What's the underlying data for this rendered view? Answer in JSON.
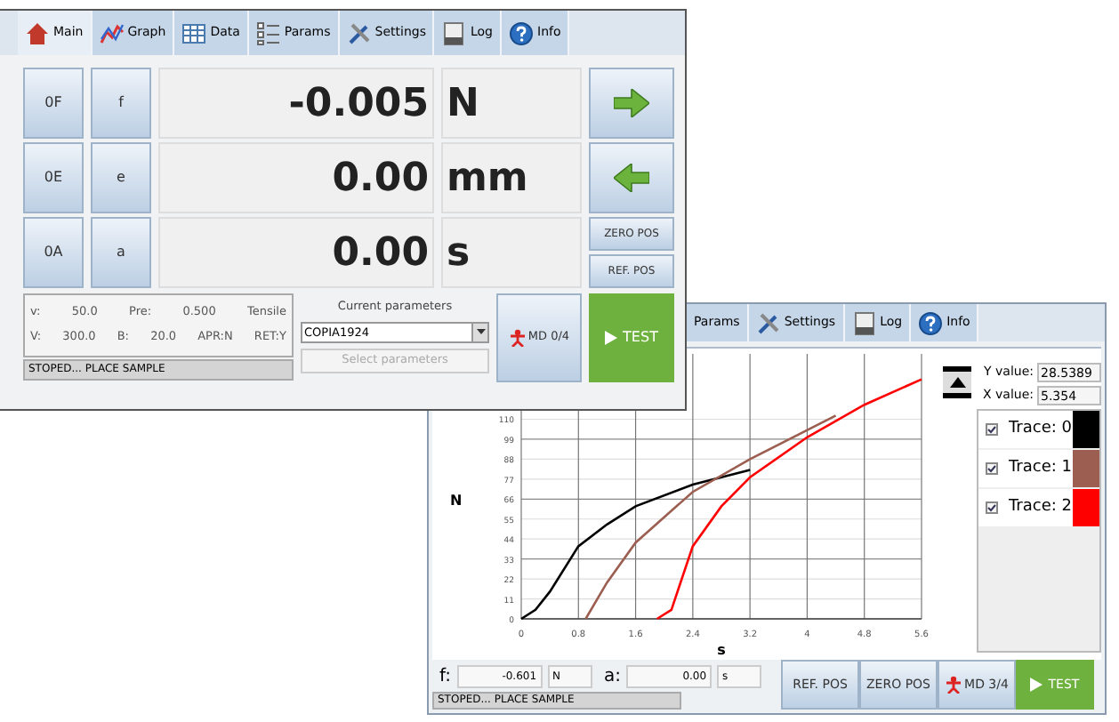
{
  "graph_window": {
    "tabs": [
      {
        "label": "Params",
        "selected": false,
        "kind": "none"
      },
      {
        "label": "Settings",
        "selected": false,
        "kind": "settings"
      },
      {
        "label": "Log",
        "selected": false,
        "kind": "log"
      },
      {
        "label": "Info",
        "selected": false,
        "kind": "info"
      }
    ],
    "chart_data": {
      "type": "line",
      "xlabel": "s",
      "ylabel": "N",
      "x": [
        0,
        0.2,
        0.4,
        0.8,
        0.9,
        1.2,
        1.6,
        1.9,
        2.1,
        2.4,
        2.8,
        3.2,
        4.0,
        4.4,
        4.8,
        5.6
      ],
      "series": [
        {
          "color": "#000000",
          "values": [
            0,
            5,
            15,
            40,
            null,
            52,
            62,
            null,
            null,
            74,
            null,
            82,
            null,
            null,
            null,
            null
          ]
        },
        {
          "color": "#9b5e50",
          "values": [
            null,
            null,
            null,
            null,
            0,
            20,
            42,
            null,
            null,
            70,
            null,
            88,
            null,
            112,
            null,
            null
          ]
        },
        {
          "color": "#ff0000",
          "values": [
            null,
            null,
            null,
            null,
            null,
            null,
            null,
            0,
            5,
            40,
            62,
            78,
            100,
            null,
            118,
            132
          ]
        }
      ],
      "grid": true,
      "xlim": [
        0,
        5.6
      ],
      "ylim": [
        0,
        146
      ],
      "xticks": [
        {
          "value": 0,
          "label": "0"
        },
        {
          "value": 0.8,
          "label": "0.8"
        },
        {
          "value": 1.6,
          "label": "1.6"
        },
        {
          "value": 2.4,
          "label": "2.4"
        },
        {
          "value": 3.2,
          "label": "3.2"
        },
        {
          "value": 4,
          "label": "4"
        },
        {
          "value": 4.8,
          "label": "4.8"
        },
        {
          "value": 5.6,
          "label": "5.6"
        }
      ],
      "yticks": [
        0,
        11,
        22,
        33,
        44,
        55,
        66,
        77,
        88,
        99,
        110
      ]
    },
    "y_value": {
      "label": "Y value:",
      "value": "28.5389"
    },
    "x_value": {
      "label": "X value:",
      "value": "5.354"
    },
    "traces": [
      {
        "label": "Trace: 0",
        "checked": true,
        "color": "#000000"
      },
      {
        "label": "Trace: 1",
        "checked": true,
        "color": "#9b5e50"
      },
      {
        "label": "Trace: 2",
        "checked": true,
        "color": "#ff0000"
      }
    ],
    "readouts": [
      {
        "label": "f:",
        "value": "-0.601",
        "unit": "N"
      },
      {
        "label": "a:",
        "value": "0.00",
        "unit": "s"
      }
    ],
    "status": "STOPED... PLACE SAMPLE",
    "buttons": [
      {
        "label": "REF. POS",
        "kind": "plain"
      },
      {
        "label": "ZERO POS",
        "kind": "plain"
      },
      {
        "label": "MD 3/4",
        "kind": "md"
      },
      {
        "label": "TEST",
        "kind": "test"
      }
    ]
  },
  "main_window": {
    "tabs": [
      {
        "label": "Main",
        "selected": true,
        "kind": "main"
      },
      {
        "label": "Graph",
        "selected": false,
        "kind": "graph"
      },
      {
        "label": "Data",
        "selected": false,
        "kind": "data"
      },
      {
        "label": "Params",
        "selected": false,
        "kind": "params"
      },
      {
        "label": "Settings",
        "selected": false,
        "kind": "settings"
      },
      {
        "label": "Log",
        "selected": false,
        "kind": "log"
      },
      {
        "label": "Info",
        "selected": false,
        "kind": "info"
      }
    ],
    "channels": [
      {
        "zero": "0F",
        "name": "f",
        "value": "-0.005",
        "unit": "N"
      },
      {
        "zero": "0E",
        "name": "e",
        "value": "0.00",
        "unit": "mm"
      },
      {
        "zero": "0A",
        "name": "a",
        "value": "0.00",
        "unit": "s"
      }
    ],
    "side_buttons": [
      {
        "label": "ZERO POS"
      },
      {
        "label": "REF. POS"
      }
    ],
    "info_lines": [
      [
        "v:",
        "50.0",
        "Pre:",
        "0.500",
        "Tensile"
      ],
      [
        "V:",
        "300.0",
        "B:",
        "20.0",
        "APR:N",
        "RET:Y"
      ]
    ],
    "status": "STOPED... PLACE SAMPLE",
    "current_parameters": {
      "label": "Current parameters",
      "value": "COPIA1924",
      "button": "Select parameters",
      "button_disabled": true
    },
    "md_button": "MD 0/4",
    "test_button": "TEST"
  }
}
